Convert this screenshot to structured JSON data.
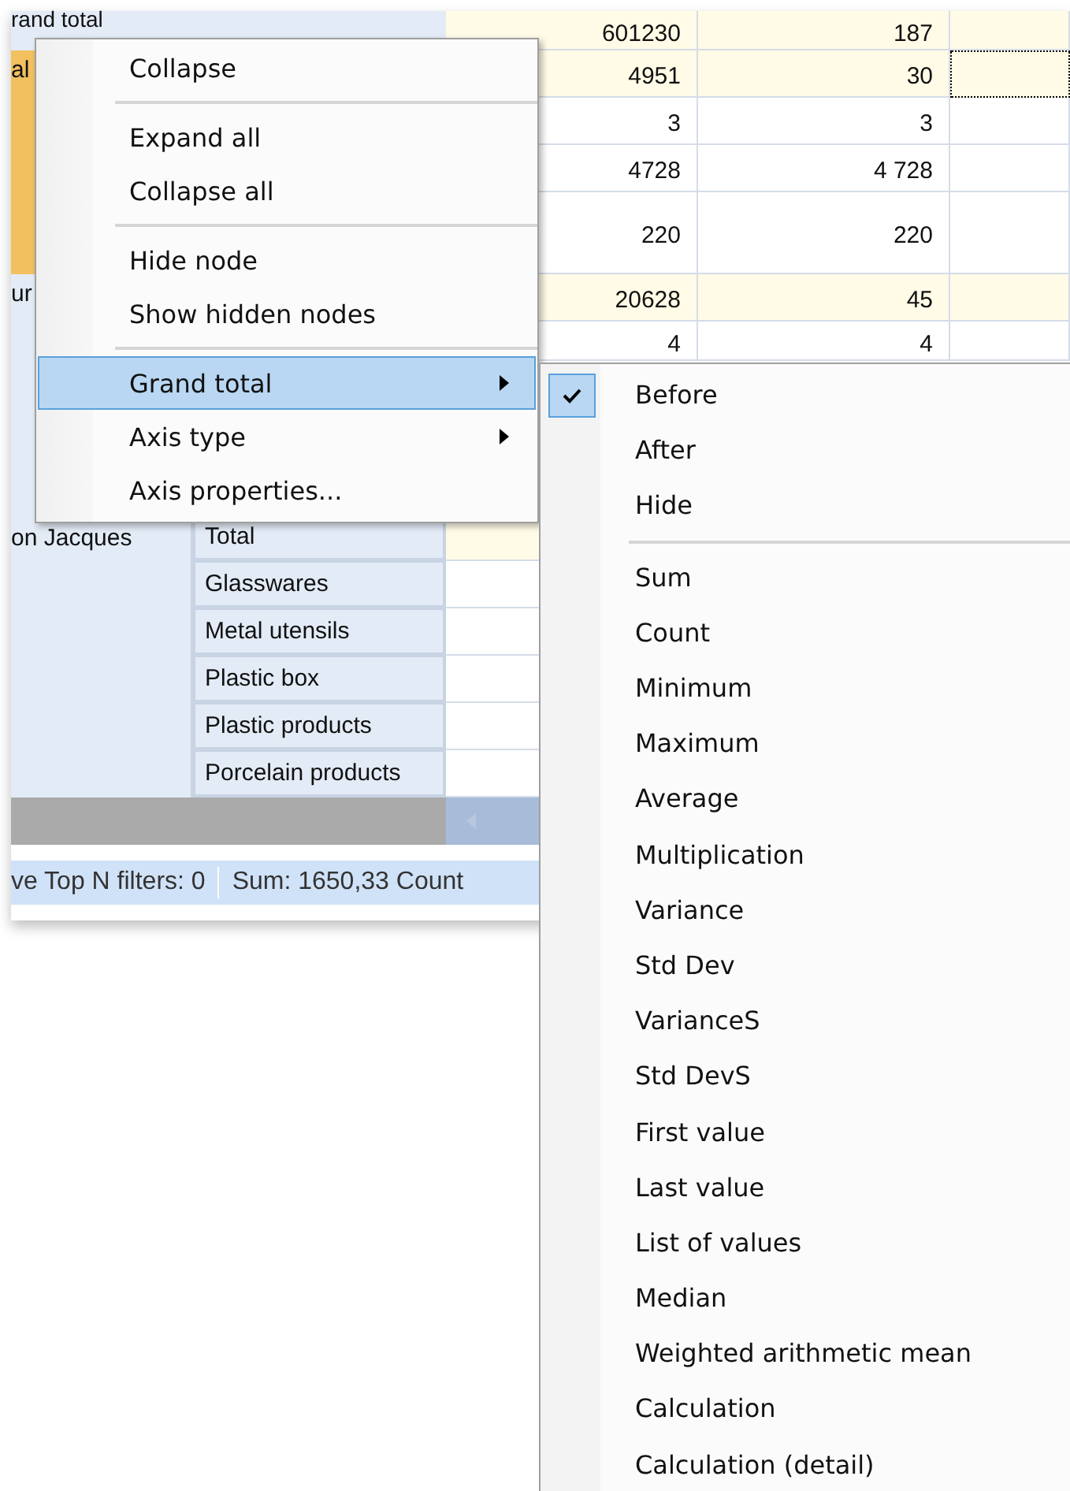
{
  "grid": {
    "top_groups": [
      {
        "header": "rand total",
        "selected": false,
        "rows": [
          {
            "total": true,
            "focused": false,
            "values": [
              "601230",
              "187"
            ]
          }
        ]
      },
      {
        "header": "al",
        "selected": true,
        "rows": [
          {
            "total": true,
            "focused": true,
            "values": [
              "4951",
              "30"
            ]
          },
          {
            "total": false,
            "focused": false,
            "values": [
              "3",
              "3"
            ]
          },
          {
            "total": false,
            "focused": false,
            "values": [
              "4728",
              "4 728"
            ]
          },
          {
            "total": false,
            "focused": false,
            "values": [
              "220",
              "220"
            ]
          }
        ]
      },
      {
        "header": "ur",
        "selected": false,
        "rows": [
          {
            "total": true,
            "focused": false,
            "values": [
              "20628",
              "45"
            ]
          },
          {
            "total": false,
            "focused": false,
            "values": [
              "4",
              "4"
            ]
          }
        ]
      }
    ],
    "group": {
      "header": "on Jacques",
      "rows": [
        {
          "label": "Total",
          "total": true
        },
        {
          "label": "Glasswares",
          "total": false
        },
        {
          "label": "Metal utensils",
          "total": false
        },
        {
          "label": "Plastic box",
          "total": false
        },
        {
          "label": "Plastic products",
          "total": false
        },
        {
          "label": "Porcelain products",
          "total": false
        }
      ]
    }
  },
  "status_bar": [
    "ve Top N filters: 0",
    "Sum: 1650,33 Count"
  ],
  "context_menu": [
    {
      "kind": "item",
      "label": "Collapse",
      "selected": false,
      "submenu": false
    },
    {
      "kind": "separator"
    },
    {
      "kind": "item",
      "label": "Expand all",
      "selected": false,
      "submenu": false
    },
    {
      "kind": "item",
      "label": "Collapse all",
      "selected": false,
      "submenu": false
    },
    {
      "kind": "separator"
    },
    {
      "kind": "item",
      "label": "Hide node",
      "selected": false,
      "submenu": false
    },
    {
      "kind": "item",
      "label": "Show hidden nodes",
      "selected": false,
      "submenu": false
    },
    {
      "kind": "separator"
    },
    {
      "kind": "item",
      "label": "Grand total",
      "selected": true,
      "submenu": true
    },
    {
      "kind": "item",
      "label": "Axis type",
      "selected": false,
      "submenu": true
    },
    {
      "kind": "item",
      "label": "Axis properties...",
      "selected": false,
      "submenu": false
    }
  ],
  "submenu": [
    {
      "kind": "item",
      "label": "Before",
      "checked": true
    },
    {
      "kind": "item",
      "label": "After",
      "checked": false
    },
    {
      "kind": "item",
      "label": "Hide",
      "checked": false
    },
    {
      "kind": "separator"
    },
    {
      "kind": "item",
      "label": "Sum",
      "checked": false
    },
    {
      "kind": "item",
      "label": "Count",
      "checked": false
    },
    {
      "kind": "item",
      "label": "Minimum",
      "checked": false
    },
    {
      "kind": "item",
      "label": "Maximum",
      "checked": false
    },
    {
      "kind": "item",
      "label": "Average",
      "checked": false
    },
    {
      "kind": "item",
      "label": "Multiplication",
      "checked": false
    },
    {
      "kind": "item",
      "label": "Variance",
      "checked": false
    },
    {
      "kind": "item",
      "label": "Std Dev",
      "checked": false
    },
    {
      "kind": "item",
      "label": "VarianceS",
      "checked": false
    },
    {
      "kind": "item",
      "label": "Std DevS",
      "checked": false
    },
    {
      "kind": "item",
      "label": "First value",
      "checked": false
    },
    {
      "kind": "item",
      "label": "Last value",
      "checked": false
    },
    {
      "kind": "item",
      "label": "List of values",
      "checked": false
    },
    {
      "kind": "item",
      "label": "Median",
      "checked": false
    },
    {
      "kind": "item",
      "label": "Weighted arithmetic mean",
      "checked": false
    },
    {
      "kind": "item",
      "label": "Calculation",
      "checked": false
    },
    {
      "kind": "item",
      "label": "Calculation (detail)",
      "checked": false
    }
  ]
}
